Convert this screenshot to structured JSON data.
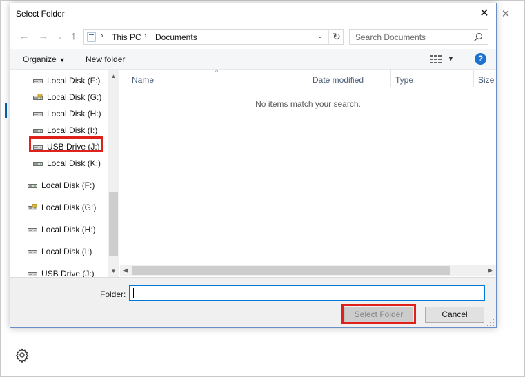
{
  "dialog": {
    "title": "Select Folder",
    "close_glyph": "✕"
  },
  "nav": {
    "back_glyph": "←",
    "forward_glyph": "→",
    "recent_glyph": "⌄",
    "up_glyph": "↑",
    "breadcrumbs": [
      "This PC",
      "Documents"
    ],
    "separator": "›",
    "dropdown_glyph": "⌄",
    "refresh_glyph": "↻"
  },
  "search": {
    "placeholder": "Search Documents",
    "icon": "search-icon"
  },
  "toolbar": {
    "organize_label": "Organize",
    "new_folder_label": "New folder",
    "help_label": "?"
  },
  "tree": {
    "items": [
      {
        "label": "Local Disk (F:)",
        "icon": "drive-icon"
      },
      {
        "label": "Local Disk (G:)",
        "icon": "locked-drive-icon"
      },
      {
        "label": "Local Disk (H:)",
        "icon": "drive-icon"
      },
      {
        "label": "Local Disk (I:)",
        "icon": "drive-icon"
      },
      {
        "label": "USB Drive (J:)",
        "icon": "usb-drive-icon"
      },
      {
        "label": "Local Disk (K:)",
        "icon": "drive-icon"
      },
      {
        "label": "Local Disk (F:)",
        "icon": "drive-icon"
      },
      {
        "label": "Local Disk (G:)",
        "icon": "locked-drive-icon"
      },
      {
        "label": "Local Disk (H:)",
        "icon": "drive-icon"
      },
      {
        "label": "Local Disk (I:)",
        "icon": "drive-icon"
      },
      {
        "label": "USB Drive (J:)",
        "icon": "usb-drive-icon"
      }
    ]
  },
  "files": {
    "columns": [
      "Name",
      "Date modified",
      "Type",
      "Size"
    ],
    "sort_glyph": "^",
    "empty_message": "No items match your search."
  },
  "footer": {
    "folder_label": "Folder:",
    "folder_value": "",
    "select_button": "Select Folder",
    "cancel_button": "Cancel"
  },
  "background": {
    "close_glyph": "✕",
    "settings_icon": "gear-icon"
  },
  "colors": {
    "accent": "#0078d7",
    "highlight": "#e0201b",
    "help": "#1a73d0"
  }
}
